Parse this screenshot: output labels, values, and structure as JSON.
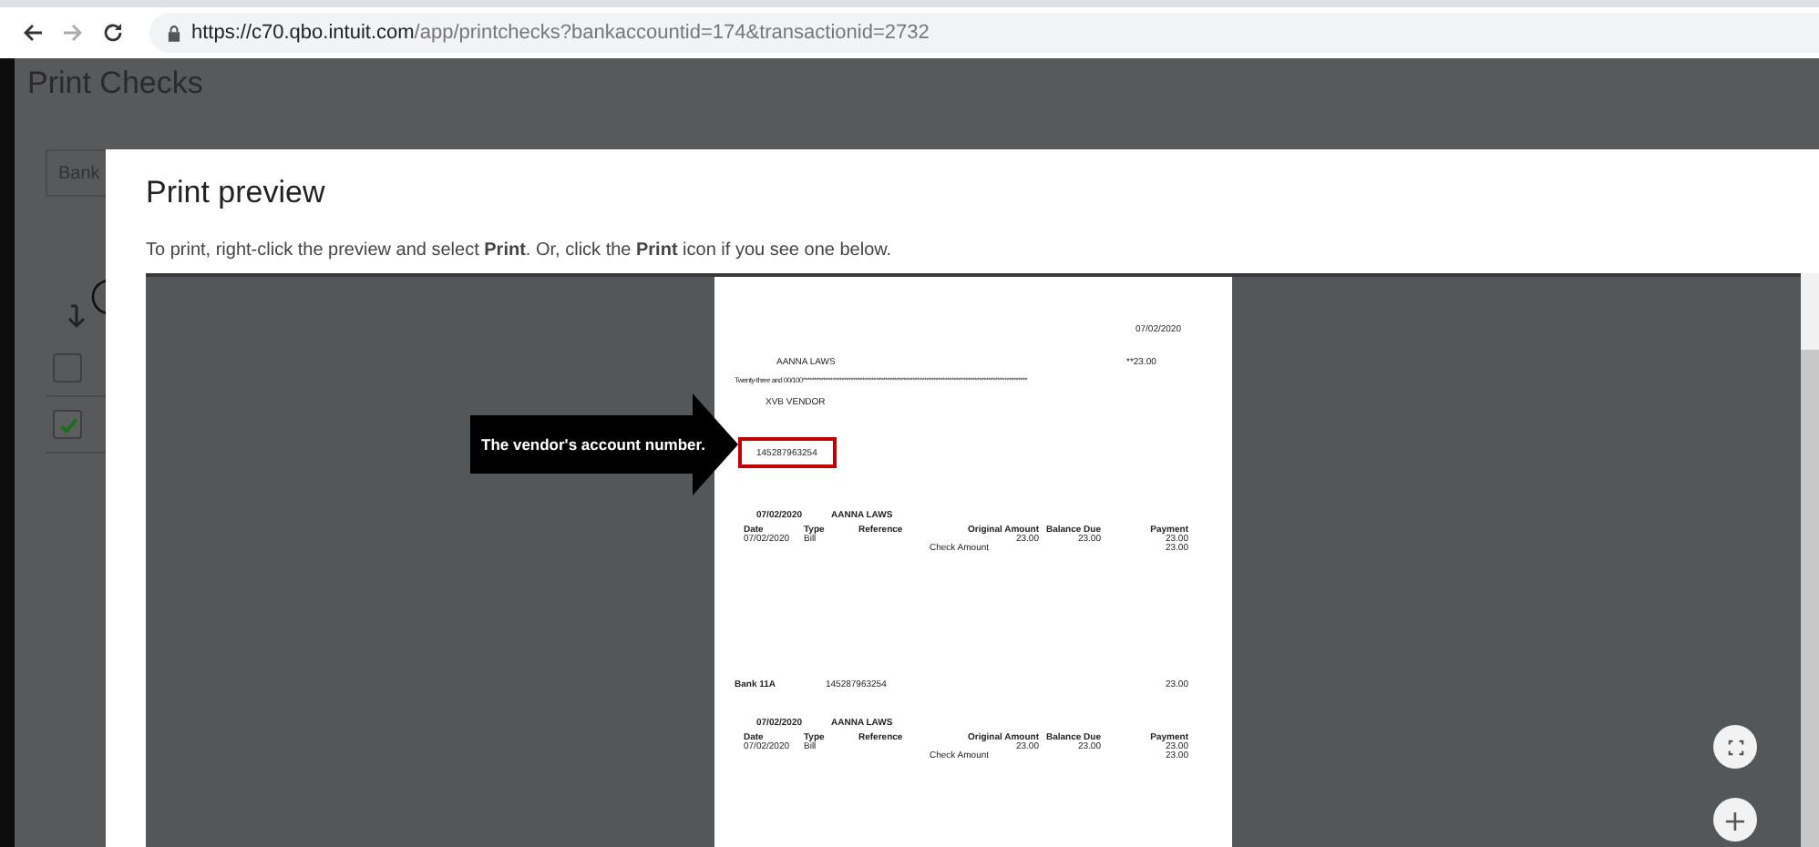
{
  "browser": {
    "url_host": "https://c70.qbo.intuit.com",
    "url_path": "/app/printchecks?bankaccountid=174&transactionid=2732"
  },
  "page": {
    "title": "Print Checks",
    "account_field": "Bank",
    "rows": [
      {
        "checked": false
      },
      {
        "checked": true
      }
    ]
  },
  "modal": {
    "title": "Print preview",
    "instruction": "To print, right-click the preview and select **Print**. Or, click the **Print** icon if you see one below.",
    "check": {
      "date": "07/02/2020",
      "payee": "AANNA LAWS",
      "amount": "**23.00",
      "amount_words": "Twenty-three and 00/100**************************************************************************************************",
      "address": "XVB VENDOR",
      "account_number": "145287963254"
    },
    "stubs": [
      {
        "date": "07/02/2020",
        "payee": "AANNA LAWS",
        "columns": [
          "Date",
          "Type",
          "Reference",
          "Original Amount",
          "Balance Due",
          "Payment"
        ],
        "row": [
          "07/02/2020",
          "Bill",
          "23.00",
          "23.00",
          "23.00"
        ],
        "check_amount_label": "Check Amount",
        "check_amount": "23.00"
      },
      {
        "bank": {
          "name": "Bank 11A",
          "number": "145287963254",
          "amount": "23.00"
        },
        "date": "07/02/2020",
        "payee": "AANNA LAWS",
        "columns": [
          "Date",
          "Type",
          "Reference",
          "Original Amount",
          "Balance Due",
          "Payment"
        ],
        "row": [
          "07/02/2020",
          "Bill",
          "23.00",
          "23.00",
          "23.00"
        ],
        "check_amount_label": "Check Amount",
        "check_amount": "23.00"
      }
    ],
    "callout": "The vendor's account number.",
    "zoom_in": "+"
  }
}
